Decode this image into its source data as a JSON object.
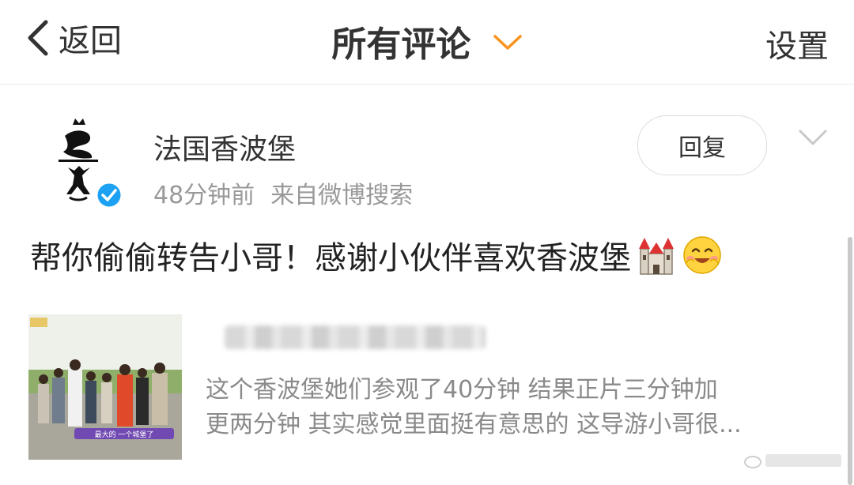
{
  "nav": {
    "back_label": "返回",
    "title": "所有评论",
    "settings_label": "设置"
  },
  "comment": {
    "author": "法国香波堡",
    "time": "48分钟前",
    "source": "来自微博搜索",
    "reply_label": "回复",
    "text": "帮你偷偷转告小哥！感谢小伙伴喜欢香波堡",
    "emojis": [
      "castle-emoji",
      "smiling-face-emoji"
    ]
  },
  "quote": {
    "thumbnail_caption": "最大的 一个城堡了",
    "text_line1": "这个香波堡她们参观了40分钟 结果正片三分钟加",
    "text_line2": "更两分钟 其实感觉里面挺有意思的 这导游小哥很..."
  },
  "colors": {
    "accent_orange": "#f7931e",
    "verified_blue": "#1da1f2",
    "muted_text": "#999999"
  }
}
